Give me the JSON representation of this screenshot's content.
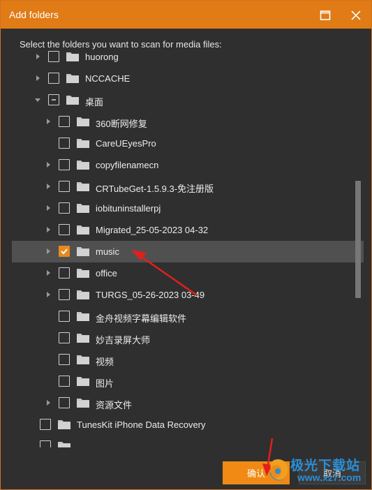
{
  "window": {
    "title": "Add folders"
  },
  "instruction": "Select the folders you want to scan for media files:",
  "tree": [
    {
      "label": "huorong",
      "expander": "collapsed",
      "state": "unchecked"
    },
    {
      "label": "NCCACHE",
      "expander": "collapsed",
      "state": "unchecked"
    },
    {
      "label": "桌面",
      "expander": "expanded",
      "state": "partial"
    },
    {
      "label": "360断网修复",
      "expander": "collapsed",
      "state": "unchecked"
    },
    {
      "label": "CareUEyesPro",
      "expander": "none",
      "state": "unchecked"
    },
    {
      "label": "copyfilenamecn",
      "expander": "collapsed",
      "state": "unchecked"
    },
    {
      "label": "CRTubeGet-1.5.9.3-免注册版",
      "expander": "collapsed",
      "state": "unchecked"
    },
    {
      "label": "iobituninstallerpj",
      "expander": "collapsed",
      "state": "unchecked"
    },
    {
      "label": "Migrated_25-05-2023 04-32",
      "expander": "collapsed",
      "state": "unchecked"
    },
    {
      "label": "music",
      "expander": "collapsed",
      "state": "checked",
      "selected": true
    },
    {
      "label": "office",
      "expander": "collapsed",
      "state": "unchecked"
    },
    {
      "label": "TURGS_05-26-2023 03-49",
      "expander": "collapsed",
      "state": "unchecked"
    },
    {
      "label": "金舟视频字幕编辑软件",
      "expander": "none",
      "state": "unchecked"
    },
    {
      "label": "妙吉录屏大师",
      "expander": "none",
      "state": "unchecked"
    },
    {
      "label": "视频",
      "expander": "none",
      "state": "unchecked"
    },
    {
      "label": "图片",
      "expander": "none",
      "state": "unchecked"
    },
    {
      "label": "资源文件",
      "expander": "collapsed",
      "state": "unchecked"
    },
    {
      "label": "TunesKit iPhone Data Recovery",
      "expander": "none",
      "state": "unchecked"
    },
    {
      "label": "",
      "expander": "none",
      "state": "unchecked"
    }
  ],
  "buttons": {
    "ok": "确认",
    "cancel": "取消"
  },
  "watermark": {
    "line1": "极光下载站",
    "line2": "www.xz7.com"
  },
  "icons": {
    "maximize": "maximize-icon",
    "close": "close-icon",
    "expander": "chevron-icon",
    "folder": "folder-icon",
    "check": "check-icon",
    "partial": "minus-icon"
  },
  "colors": {
    "titlebar": "#e07b16",
    "accent": "#f08a14",
    "background": "#2f2f2f",
    "selected_row": "#505050",
    "folder": "#c8c8c8",
    "arrow": "#e0201c",
    "watermark": "#2a8ed8"
  }
}
